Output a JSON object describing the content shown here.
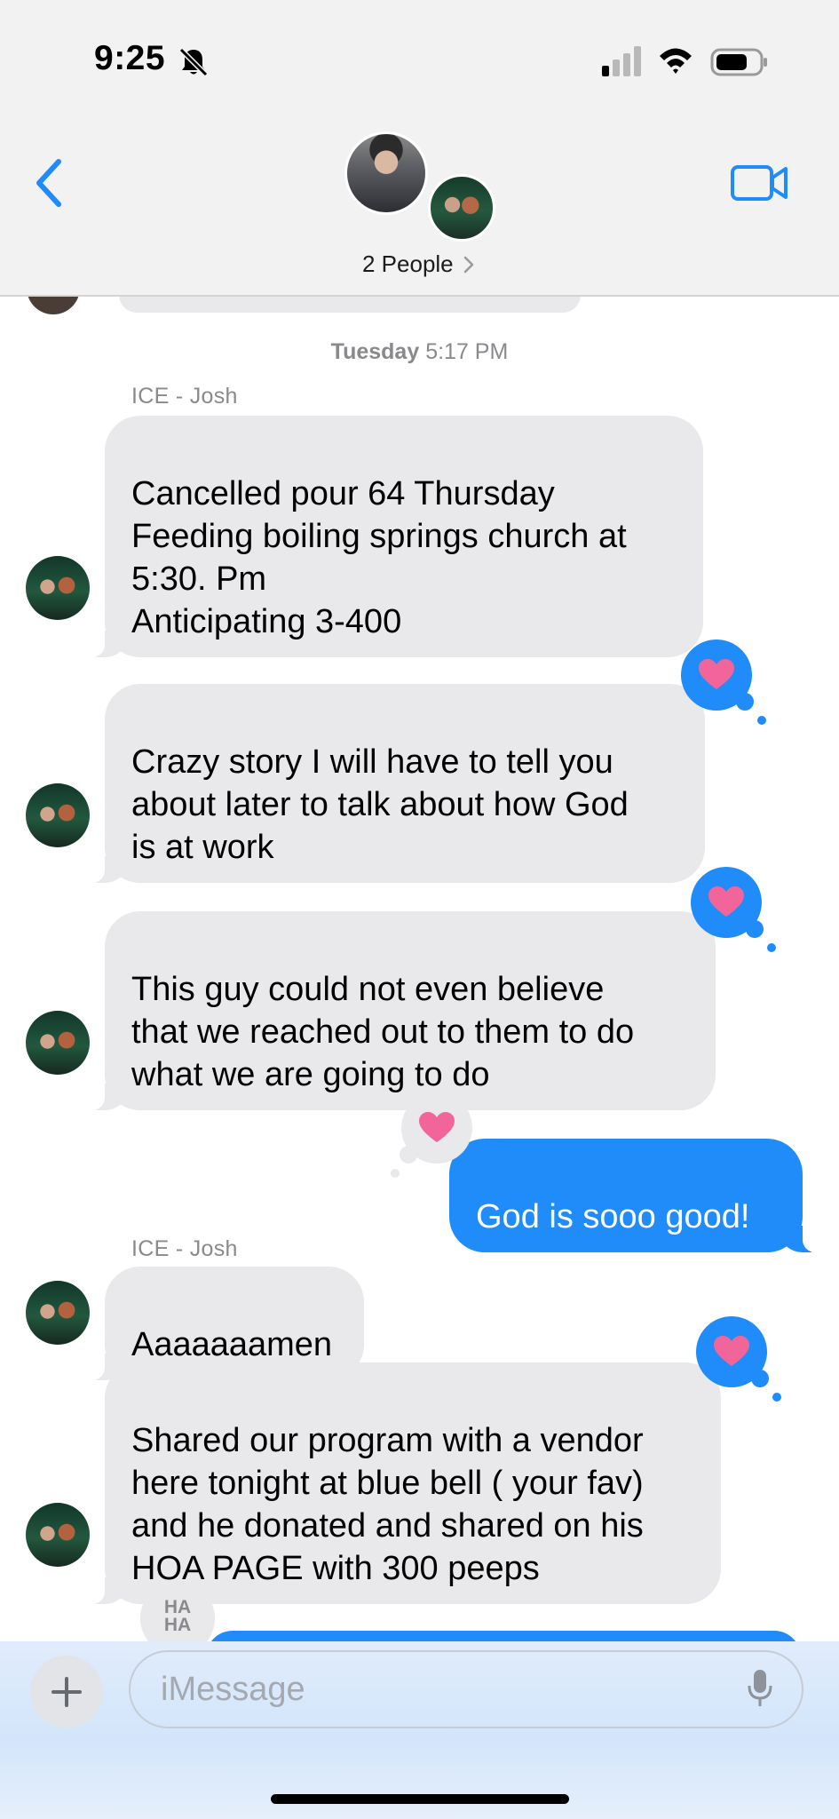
{
  "status_bar": {
    "time": "9:25",
    "icons": [
      "bell-slash-icon",
      "cellular-signal-icon",
      "wifi-icon",
      "battery-icon"
    ]
  },
  "header": {
    "back_icon": "chevron-left-icon",
    "people_label": "2 People",
    "people_chevron": "chevron-right-icon",
    "video_icon": "video-camera-icon",
    "accent_color": "#1f8cf9"
  },
  "thread": {
    "timestamp_day": "Tuesday",
    "timestamp_time": "5:17 PM",
    "messages": [
      {
        "sender": "ICE - Josh",
        "direction": "incoming",
        "text": "Cancelled pour 64 Thursday\nFeeding boiling springs church at\n5:30. Pm\nAnticipating 3-400",
        "tapback": null
      },
      {
        "sender": "",
        "direction": "incoming",
        "text": "Crazy story I will have to tell you\nabout later to talk about how God\nis at work",
        "tapback": "heart"
      },
      {
        "sender": "",
        "direction": "incoming",
        "text": "This guy could not even believe\nthat we reached out to them to do\nwhat we are going to do",
        "tapback": "heart"
      },
      {
        "sender": "",
        "direction": "outgoing",
        "text": "God is sooo good!",
        "tapback": "heart"
      },
      {
        "sender": "ICE - Josh",
        "direction": "incoming",
        "text": "Aaaaaaamen",
        "tapback": null
      },
      {
        "sender": "",
        "direction": "incoming",
        "text": "Shared our program with a vendor\nhere tonight at blue bell ( your fav)\nand he donated and shared on his\nHOA PAGE with 300 peeps",
        "tapback": "heart"
      }
    ],
    "partial_tapback": "HA\nHA"
  },
  "composer": {
    "plus_icon": "plus-icon",
    "placeholder": "iMessage",
    "mic_icon": "microphone-icon"
  },
  "colors": {
    "incoming_bubble": "#e9e9eb",
    "outgoing_bubble": "#1f8cf9",
    "heart": "#f2659a"
  }
}
